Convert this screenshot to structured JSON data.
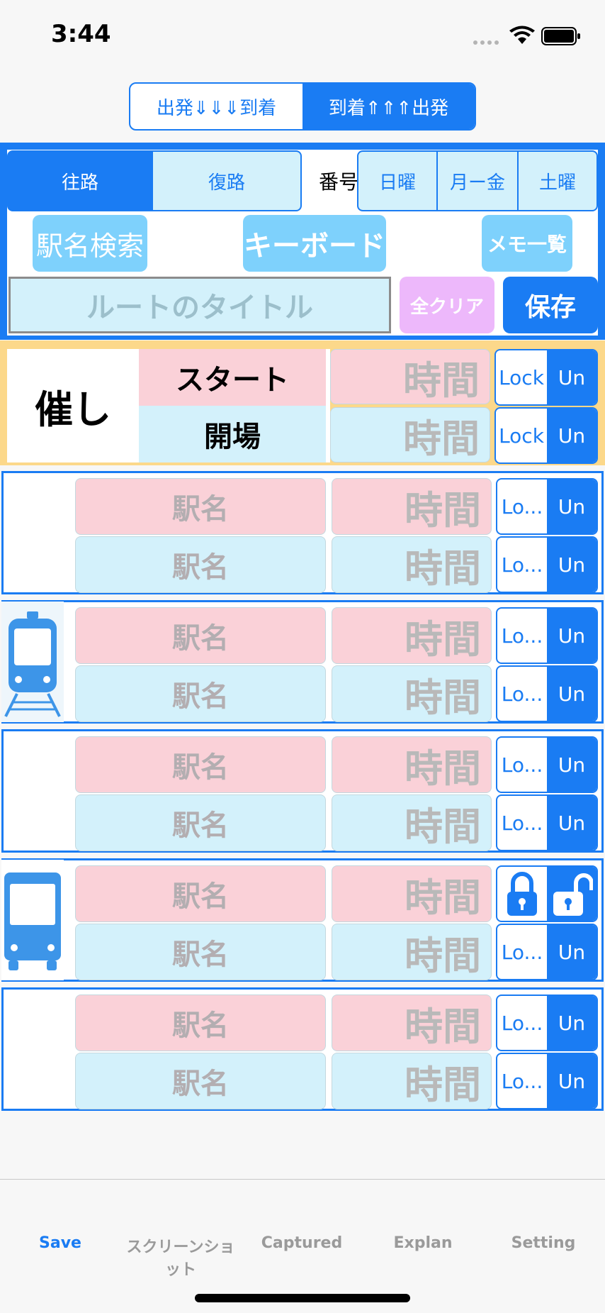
{
  "status": {
    "time": "3:44"
  },
  "direction": {
    "depart_arrive": "出発⇓⇓⇓到着",
    "arrive_depart": "到着⇑⇑⇑出発"
  },
  "tabs": {
    "outbound": "往路",
    "return": "復路",
    "number": "番号",
    "sunday": "日曜",
    "weekday": "月ー金",
    "saturday": "土曜"
  },
  "buttons": {
    "station_search": "駅名検索",
    "keyboard": "キーボード",
    "memo_list": "メモ一覧",
    "clear_all": "全クリア",
    "save": "保存"
  },
  "route_title_placeholder": "ルートのタイトル",
  "event": {
    "label": "催し",
    "start": "スタート",
    "open": "開場",
    "time": "時間",
    "lock": "Lock",
    "unlock": "Un"
  },
  "rows": [
    {
      "icon": "",
      "dep_station": "駅名",
      "arr_station": "駅名",
      "dep_time": "時間",
      "arr_time": "時間",
      "lock": "Lo...",
      "unlock": "Un"
    },
    {
      "icon": "train-icon",
      "dep_station": "駅名",
      "arr_station": "駅名",
      "dep_time": "時間",
      "arr_time": "時間",
      "lock": "Lo...",
      "unlock": "Un"
    },
    {
      "icon": "",
      "dep_station": "駅名",
      "arr_station": "駅名",
      "dep_time": "時間",
      "arr_time": "時間",
      "lock": "Lo...",
      "unlock": "Un"
    },
    {
      "icon": "bus-icon",
      "dep_station": "駅名",
      "arr_station": "駅名",
      "dep_time": "時間",
      "arr_time": "時間",
      "lock": "Lo...",
      "unlock": "Un"
    },
    {
      "icon": "",
      "dep_station": "駅名",
      "arr_station": "駅名",
      "dep_time": "時間",
      "arr_time": "時間",
      "lock": "Lo...",
      "unlock": "Un"
    }
  ],
  "tabbar": {
    "save": "Save",
    "screenshot": "スクリーンショット",
    "captured": "Captured",
    "explan": "Explan",
    "setting": "Setting"
  },
  "colors": {
    "accent": "#1a7cf3",
    "light_blue": "#d3f1fb",
    "pink": "#fad1d8",
    "event_bg": "#fcd88a",
    "pill_blue": "#7ed1fc",
    "clear_purple": "#edb8fb"
  }
}
